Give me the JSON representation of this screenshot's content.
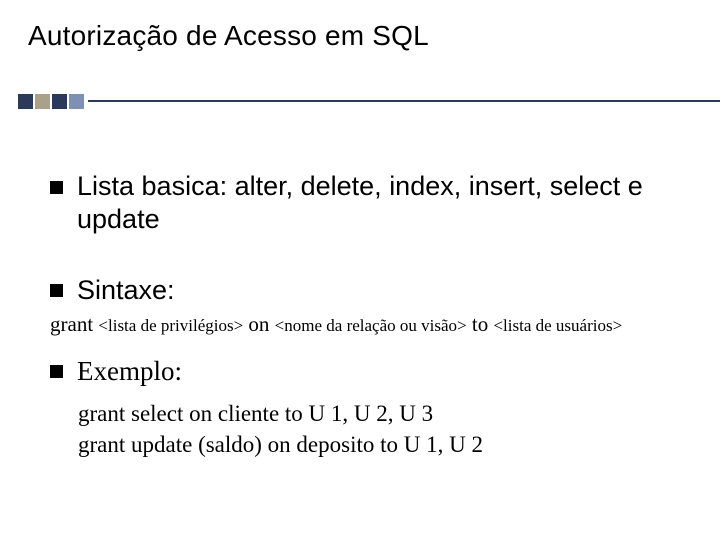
{
  "title": "Autorização de Acesso em SQL",
  "bullets": {
    "lista": "Lista basica: alter, delete, index, insert, select e update",
    "sintaxe": "Sintaxe:",
    "exemplo": "Exemplo:"
  },
  "syntax": {
    "grant": "grant",
    "priv_ph": "<lista de privilégios>",
    "on": "on",
    "rel_ph": "<nome da relação ou visão>",
    "to": "to",
    "user_ph": "<lista de usuários>"
  },
  "examples": {
    "line1": "grant select on cliente to U 1, U 2, U 3",
    "line2": "grant update (saldo) on deposito to U 1, U 2"
  }
}
